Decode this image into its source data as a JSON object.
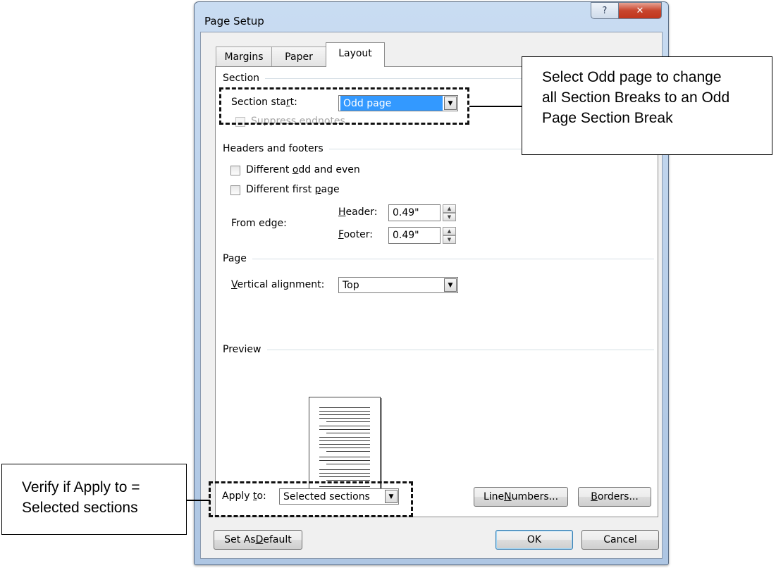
{
  "dialog": {
    "title": "Page Setup",
    "help_glyph": "?",
    "close_glyph": "✕"
  },
  "tabs": [
    {
      "label": "Margins",
      "selected": false
    },
    {
      "label": "Paper",
      "selected": false
    },
    {
      "label": "Layout",
      "selected": true
    }
  ],
  "section": {
    "group_label": "Section",
    "start_label_pre": "Section sta",
    "start_label_ul": "r",
    "start_label_post": "t:",
    "start_value": "Odd page",
    "suppress_endnotes_label": "Suppress endnotes",
    "suppress_endnotes_checked": false,
    "suppress_endnotes_enabled": false
  },
  "headers_footers": {
    "group_label": "Headers and footers",
    "odd_even_pre": "Different ",
    "odd_even_ul": "o",
    "odd_even_post": "dd and even",
    "odd_even_checked": false,
    "first_page_pre": "Different first ",
    "first_page_ul": "p",
    "first_page_post": "age",
    "first_page_checked": false,
    "from_edge_label": "From edge:",
    "header_ul": "H",
    "header_rest": "eader:",
    "header_value": "0.49\"",
    "footer_ul": "F",
    "footer_rest": "ooter:",
    "footer_value": "0.49\""
  },
  "page": {
    "group_label": "Page",
    "valign_ul": "V",
    "valign_rest": "ertical alignment:",
    "valign_value": "Top"
  },
  "preview": {
    "group_label": "Preview"
  },
  "apply": {
    "label_pre": "Apply ",
    "label_ul": "t",
    "label_post": "o:",
    "value": "Selected sections"
  },
  "buttons": {
    "line_numbers_pre": "Line ",
    "line_numbers_ul": "N",
    "line_numbers_post": "umbers...",
    "borders_ul": "B",
    "borders_post": "orders...",
    "set_default_pre": "Set As ",
    "set_default_ul": "D",
    "set_default_post": "efault",
    "ok": "OK",
    "cancel": "Cancel"
  },
  "annotations": {
    "top_callout": [
      "Select Odd page to change",
      "all Section Breaks to an Odd",
      "Page Section Break"
    ],
    "left_callout": [
      "Verify if Apply to =",
      "Selected sections"
    ]
  }
}
